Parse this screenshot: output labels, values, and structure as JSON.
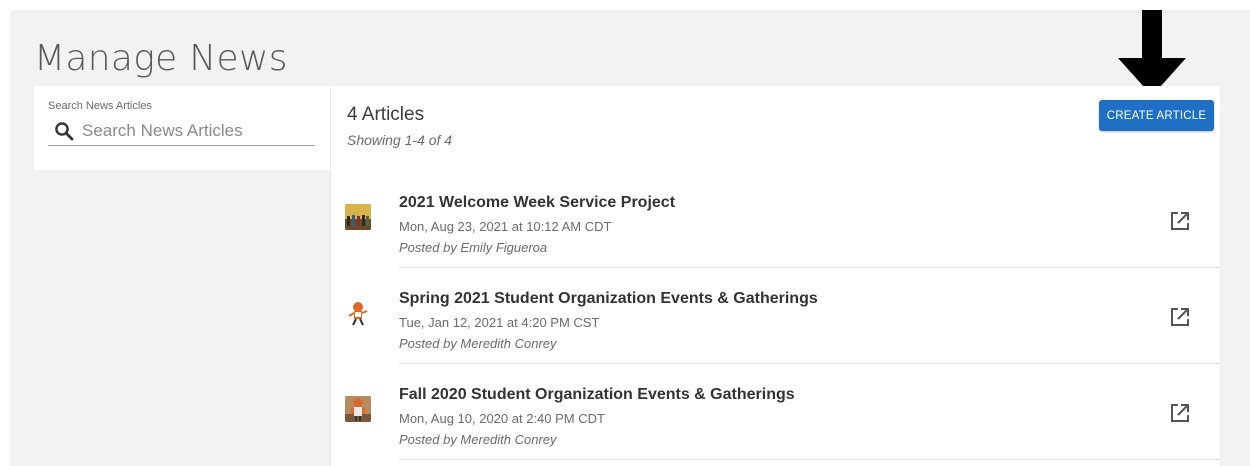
{
  "page": {
    "title": "Manage News"
  },
  "search": {
    "label": "Search News Articles",
    "placeholder": "Search News Articles",
    "value": "",
    "icon": "search-icon"
  },
  "list": {
    "count_label": "4 Articles",
    "showing_label": "Showing 1-4 of 4",
    "create_button_label": "CREATE ARTICLE",
    "articles": [
      {
        "title": "2021 Welcome Week Service Project",
        "date": "Mon, Aug 23, 2021 at 10:12 AM CDT",
        "author": "Posted by Emily Figueroa",
        "thumbnail": "group-photo-thumbnail"
      },
      {
        "title": "Spring 2021 Student Organization Events & Gatherings",
        "date": "Tue, Jan 12, 2021 at 4:20 PM CST",
        "author": "Posted by Meredith Conrey",
        "thumbnail": "mascot-cartoon-thumbnail"
      },
      {
        "title": "Fall 2020 Student Organization Events & Gatherings",
        "date": "Mon, Aug 10, 2020 at 2:40 PM CDT",
        "author": "Posted by Meredith Conrey",
        "thumbnail": "mascot-photo-thumbnail"
      }
    ]
  },
  "colors": {
    "accent": "#1f6fc5",
    "page_background": "#f2f2f2",
    "annotation_arrow": "#000000"
  }
}
